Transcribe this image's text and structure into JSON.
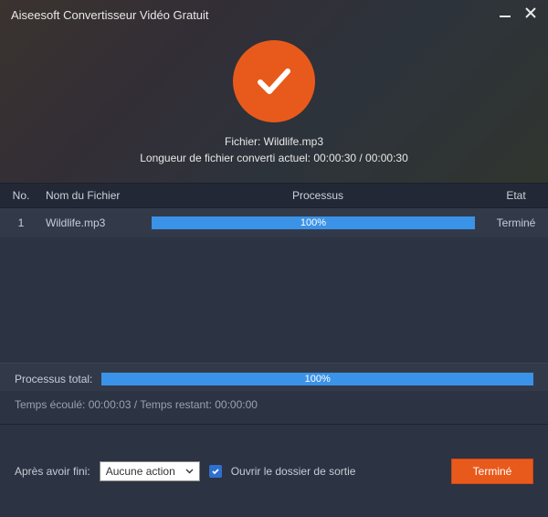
{
  "app": {
    "title": "Aiseesoft Convertisseur Vidéo Gratuit"
  },
  "status": {
    "file_label": "Fichier: Wildlife.mp3",
    "length_label": "Longueur de fichier converti actuel: 00:00:30 / 00:00:30"
  },
  "columns": {
    "no": "No.",
    "name": "Nom du Fichier",
    "process": "Processus",
    "etat": "Etat"
  },
  "rows": [
    {
      "no": "1",
      "name": "Wildlife.mp3",
      "progress": "100%",
      "etat": "Terminé"
    }
  ],
  "total": {
    "label": "Processus total:",
    "progress": "100%"
  },
  "times": "Temps écoulé: 00:00:03 / Temps restant: 00:00:00",
  "footer": {
    "after_label": "Après avoir fini:",
    "select_value": "Aucune action",
    "open_folder": "Ouvrir le dossier de sortie",
    "done": "Terminé"
  }
}
